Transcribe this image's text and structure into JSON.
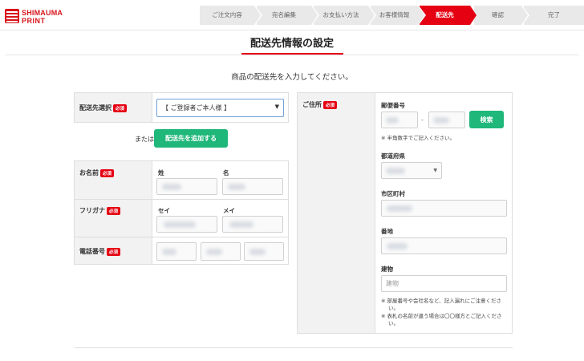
{
  "header": {
    "logo_line1": "SHIMAUMA",
    "logo_line2": "PRINT",
    "steps": [
      {
        "label": "ご注文内容",
        "active": false
      },
      {
        "label": "宛名編集",
        "active": false
      },
      {
        "label": "お支払い方法",
        "active": false
      },
      {
        "label": "お客様情報",
        "active": false
      },
      {
        "label": "配送先",
        "active": true
      },
      {
        "label": "確認",
        "active": false
      },
      {
        "label": "完了",
        "active": false
      }
    ]
  },
  "page": {
    "title": "配送先情報の設定",
    "instruction": "商品の配送先を入力してください。",
    "required_label": "必須"
  },
  "destination": {
    "label": "配送先選択",
    "selected": "【 ご登録者ご本人様 】",
    "or_text": "または",
    "add_button": "配送先を追加する"
  },
  "name_section": {
    "name_label": "お名前",
    "sei_label": "姓",
    "mei_label": "名",
    "kana_label": "フリガナ",
    "sei_kana_label": "セイ",
    "mei_kana_label": "メイ",
    "phone_label": "電話番号"
  },
  "address": {
    "label": "ご住所",
    "postal_label": "郵便番号",
    "postal_dash": "-",
    "search_button": "検索",
    "postal_note": "※ 半角数字でご記入ください。",
    "prefecture_label": "都道府県",
    "city_label": "市区町村",
    "street_label": "番地",
    "building_label": "建物",
    "building_placeholder": "建物",
    "note1_line1": "※ 部屋番号や会社名など、記入漏れにご注意くださ",
    "note1_line2": "い。",
    "note2_line1": "※ 表札の名前が違う場合は〇〇様方とご記入くださ",
    "note2_line2": "い。"
  }
}
